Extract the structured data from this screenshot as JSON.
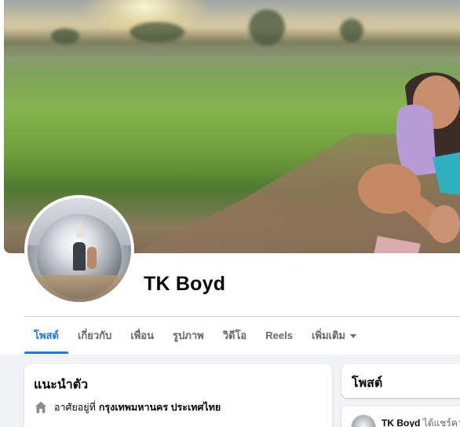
{
  "profile": {
    "name": "TK Boyd"
  },
  "tabs": [
    {
      "label": "โพสต์",
      "active": true
    },
    {
      "label": "เกี่ยวกับ",
      "active": false
    },
    {
      "label": "เพื่อน",
      "active": false
    },
    {
      "label": "รูปภาพ",
      "active": false
    },
    {
      "label": "วิดีโอ",
      "active": false
    },
    {
      "label": "Reels",
      "active": false
    },
    {
      "label": "เพิ่มเติม",
      "active": false
    }
  ],
  "intro": {
    "title": "แนะนำตัว",
    "lives_in_prefix": "อาศัยอยู่ที่",
    "lives_in_place": "กรุงเทพมหานคร ประเทศไทย",
    "icon": "home-icon"
  },
  "posts_card": {
    "title": "โพสต์"
  },
  "post": {
    "author": "TK Boyd",
    "action": "ได้แชร์ความ"
  },
  "colors": {
    "accent": "#1877f2",
    "secondary_text": "#65676b",
    "page_bg": "#f0f2f5"
  }
}
